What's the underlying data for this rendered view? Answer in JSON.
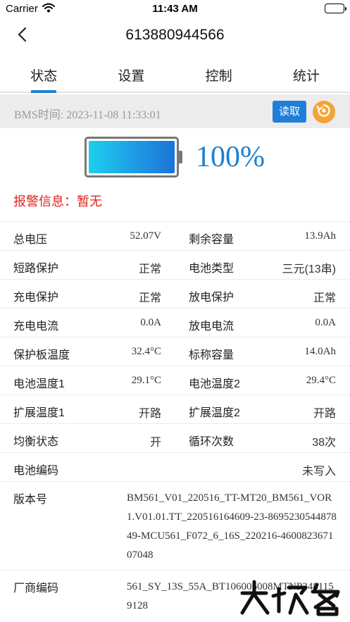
{
  "status_bar": {
    "carrier": "Carrier",
    "time": "11:43 AM"
  },
  "nav": {
    "title": "613880944566"
  },
  "tabs": [
    {
      "label": "状态",
      "active": true
    },
    {
      "label": "设置",
      "active": false
    },
    {
      "label": "控制",
      "active": false
    },
    {
      "label": "统计",
      "active": false
    }
  ],
  "bms": {
    "time_text": "BMS时间: 2023-11-08 11:33:01",
    "read_label": "读取"
  },
  "battery": {
    "percent_text": "100%",
    "level": 1.0
  },
  "alarm": {
    "text": "报警信息：暂无"
  },
  "rows": [
    {
      "l1": "总电压",
      "v1": "52.07V",
      "l2": "剩余容量",
      "v2": "13.9Ah"
    },
    {
      "l1": "短路保护",
      "v1": "正常",
      "l2": "电池类型",
      "v2": "三元(13串)"
    },
    {
      "l1": "充电保护",
      "v1": "正常",
      "l2": "放电保护",
      "v2": "正常"
    },
    {
      "l1": "充电电流",
      "v1": "0.0A",
      "l2": "放电电流",
      "v2": "0.0A"
    },
    {
      "l1": "保护板温度",
      "v1": "32.4°C",
      "l2": "标称容量",
      "v2": "14.0Ah"
    },
    {
      "l1": "电池温度1",
      "v1": "29.1°C",
      "l2": "电池温度2",
      "v2": "29.4°C"
    },
    {
      "l1": "扩展温度1",
      "v1": "开路",
      "l2": "扩展温度2",
      "v2": "开路"
    },
    {
      "l1": "均衡状态",
      "v1": "开",
      "l2": "循环次数",
      "v2": "38次"
    }
  ],
  "battery_code": {
    "label": "电池编码",
    "value": "未写入"
  },
  "version": {
    "label": "版本号",
    "value": "BM561_V01_220516_TT-MT20_BM561_VOR1.V01.01.TT_220516164609-23-869523054487849-MCU561_F072_6_16S_220216-460082367107048"
  },
  "vendor": {
    "label": "厂商编码",
    "value": "561_SY_13S_55A_BT106005008MTNP2481159128"
  },
  "colors": {
    "accent": "#1f7fd6",
    "alarm": "#e0241b",
    "refresh": "#f5a336"
  },
  "icons": {
    "back": "chevron-left-icon",
    "refresh": "refresh-icon",
    "wifi": "wifi-icon"
  }
}
